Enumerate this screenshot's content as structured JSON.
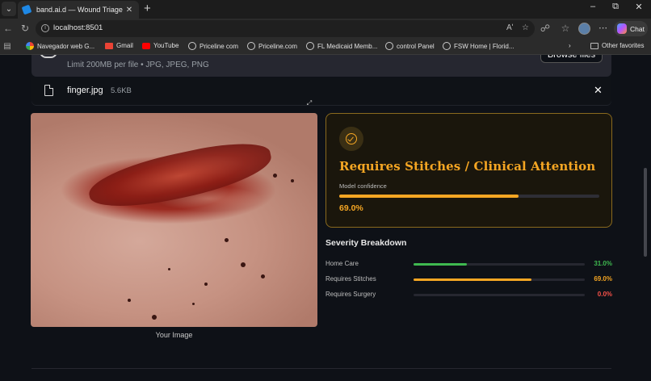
{
  "browser": {
    "tab_title": "band.ai.d — Wound Triage",
    "url": "localhost:8501",
    "chat_label": "Chat",
    "favorites": [
      {
        "label": "Navegador web G...",
        "icon": "google-icon"
      },
      {
        "label": "Gmail",
        "icon": "gmail-icon"
      },
      {
        "label": "YouTube",
        "icon": "youtube-icon"
      },
      {
        "label": "Priceline com",
        "icon": "globe-icon"
      },
      {
        "label": "Priceline.com",
        "icon": "globe-icon"
      },
      {
        "label": "FL Medicaid Memb...",
        "icon": "globe-icon"
      },
      {
        "label": "control Panel",
        "icon": "globe-icon"
      },
      {
        "label": "FSW Home | Florid...",
        "icon": "globe-icon"
      }
    ],
    "other_favorites": "Other favorites"
  },
  "uploader": {
    "limit_text": "Limit 200MB per file • JPG, JPEG, PNG",
    "browse_label": "Browse files",
    "file_name": "finger.jpg",
    "file_size": "5.6KB"
  },
  "image": {
    "caption": "Your Image"
  },
  "result": {
    "title": "Requires Stitches / Clinical Attention",
    "confidence_label": "Model confidence",
    "confidence_value": "69.0%",
    "confidence_fraction": 0.69,
    "accent": "#f5a623"
  },
  "breakdown": {
    "title": "Severity Breakdown",
    "rows": [
      {
        "label": "Home Care",
        "value": "31.0%",
        "fraction": 0.31,
        "color": "#3fb950"
      },
      {
        "label": "Requires Stitches",
        "value": "69.0%",
        "fraction": 0.69,
        "color": "#f5a623"
      },
      {
        "label": "Requires Surgery",
        "value": "0.0%",
        "fraction": 0.0,
        "color": "#f85149"
      }
    ]
  }
}
